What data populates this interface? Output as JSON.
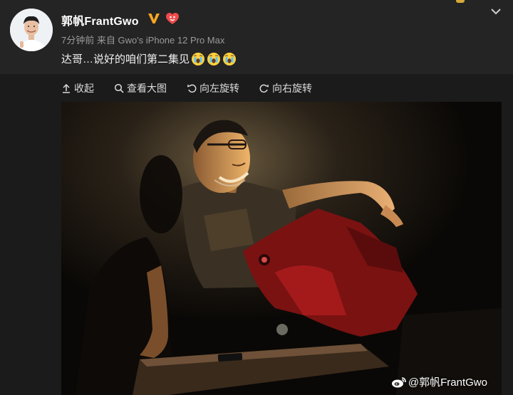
{
  "post": {
    "username": "郭帆FrantGwo",
    "time_source": "7分钟前 来自 Gwo's iPhone 12 Pro Max",
    "text": "达哥…说好的咱们第二集见",
    "emoji_count": 3
  },
  "toolbar": {
    "collapse_label": "收起",
    "view_large_label": "查看大图",
    "rotate_left_label": "向左旋转",
    "rotate_right_label": "向右旋转"
  },
  "photo": {
    "watermark": "@郭帆FrantGwo"
  },
  "icons": {
    "verified": "verified-v-icon",
    "vip": "vip-heart-icon",
    "expand": "chevron-down-icon",
    "emoji": "crying-emoji-icon",
    "collapse": "collapse-up-icon",
    "view": "search-icon",
    "rotate_left": "rotate-left-icon",
    "rotate_right": "rotate-right-icon",
    "weibo": "weibo-logo-icon"
  },
  "colors": {
    "background": "#1b1b1b",
    "header": "#242424",
    "verified": "#f5a623",
    "vip": "#f04b4b",
    "text": "#f0f0f0",
    "meta": "#9a9a9a"
  }
}
